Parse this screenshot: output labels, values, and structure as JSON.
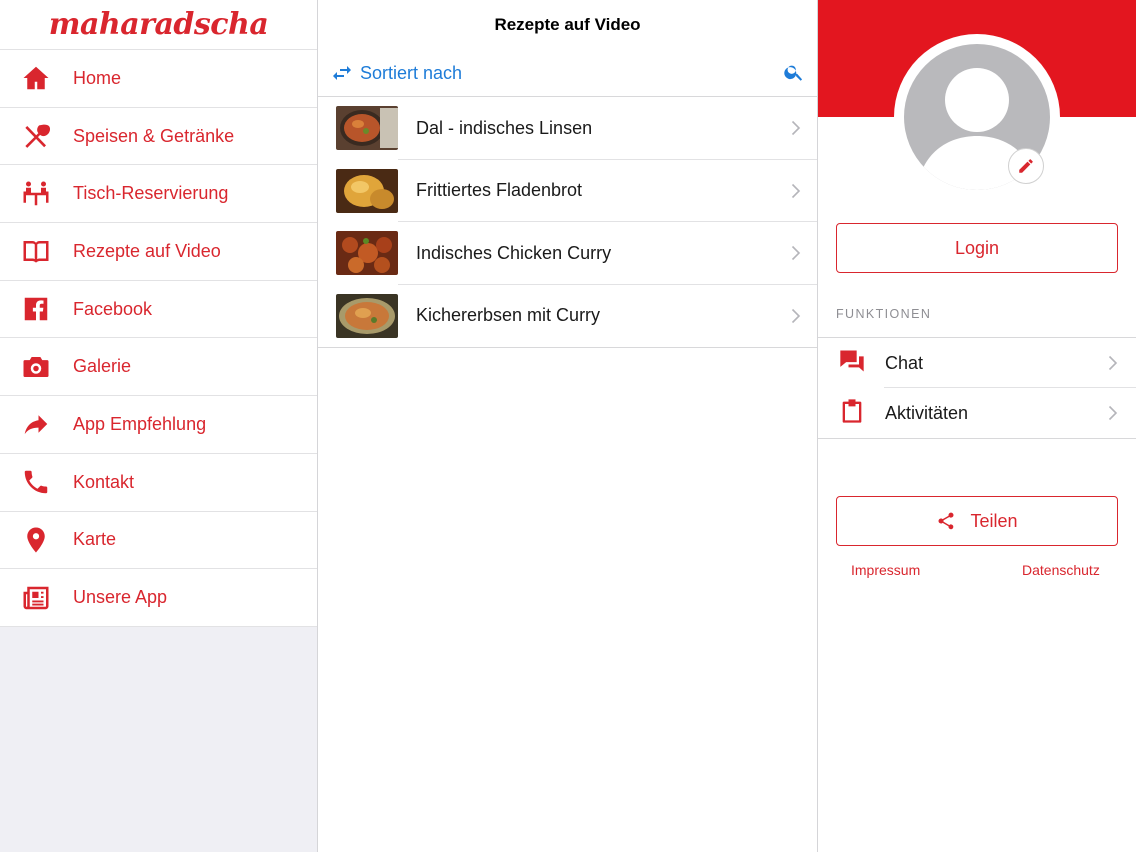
{
  "sidebar": {
    "logo": "maharadscha",
    "items": [
      {
        "label": "Home",
        "icon": "home-icon"
      },
      {
        "label": "Speisen & Getränke",
        "icon": "fork-spoon-icon"
      },
      {
        "label": "Tisch-Reservierung",
        "icon": "table-reservation-icon"
      },
      {
        "label": "Rezepte auf Video",
        "icon": "book-icon"
      },
      {
        "label": "Facebook",
        "icon": "facebook-icon"
      },
      {
        "label": "Galerie",
        "icon": "camera-icon"
      },
      {
        "label": "App Empfehlung",
        "icon": "share-arrow-icon"
      },
      {
        "label": "Kontakt",
        "icon": "phone-icon"
      },
      {
        "label": "Karte",
        "icon": "map-pin-icon"
      },
      {
        "label": "Unsere App",
        "icon": "newspaper-icon"
      }
    ]
  },
  "main": {
    "title": "Rezepte auf Video",
    "sort_label": "Sortiert nach",
    "recipes": [
      {
        "label": "Dal - indisches Linsen"
      },
      {
        "label": "Frittiertes Fladenbrot"
      },
      {
        "label": "Indisches Chicken Curry"
      },
      {
        "label": "Kichererbsen mit Curry"
      }
    ]
  },
  "profile": {
    "login_label": "Login",
    "section_title": "FUNKTIONEN",
    "functions": [
      {
        "label": "Chat",
        "icon": "chat-icon"
      },
      {
        "label": "Aktivitäten",
        "icon": "clipboard-icon"
      }
    ],
    "share_label": "Teilen",
    "impressum_label": "Impressum",
    "datenschutz_label": "Datenschutz"
  },
  "colors": {
    "brand_red": "#d9262e",
    "header_red": "#e3161f",
    "link_blue": "#1e7cd8"
  }
}
